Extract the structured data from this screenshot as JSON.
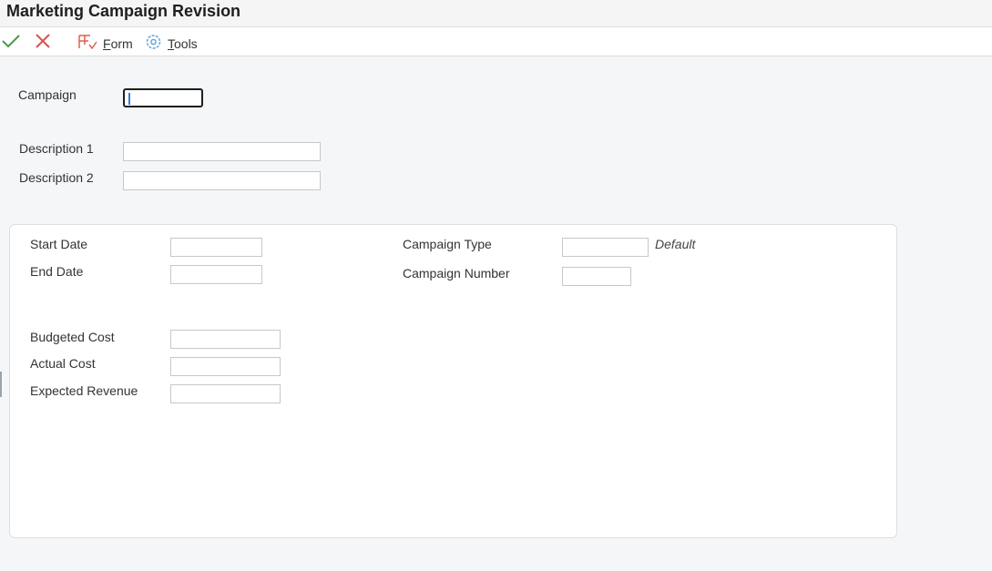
{
  "window": {
    "title": "Marketing Campaign Revision"
  },
  "toolbar": {
    "ok_icon": "checkmark-icon",
    "cancel_icon": "close-icon",
    "form_label": "Form",
    "tools_label": "Tools"
  },
  "header_fields": {
    "campaign": {
      "label": "Campaign",
      "value": ""
    },
    "description1": {
      "label": "Description 1",
      "value": ""
    },
    "description2": {
      "label": "Description 2",
      "value": ""
    }
  },
  "details": {
    "start_date": {
      "label": "Start Date",
      "value": ""
    },
    "end_date": {
      "label": "End Date",
      "value": ""
    },
    "campaign_type": {
      "label": "Campaign Type",
      "value": "",
      "hint": "Default"
    },
    "campaign_number": {
      "label": "Campaign Number",
      "value": ""
    },
    "budgeted_cost": {
      "label": "Budgeted Cost",
      "value": ""
    },
    "actual_cost": {
      "label": "Actual Cost",
      "value": ""
    },
    "expected_revenue": {
      "label": "Expected Revenue",
      "value": ""
    }
  },
  "colors": {
    "ok": "#4a9a4a",
    "cancel": "#d9534f",
    "form_icon": "#e0604c",
    "tools_icon": "#5aa0d6"
  }
}
